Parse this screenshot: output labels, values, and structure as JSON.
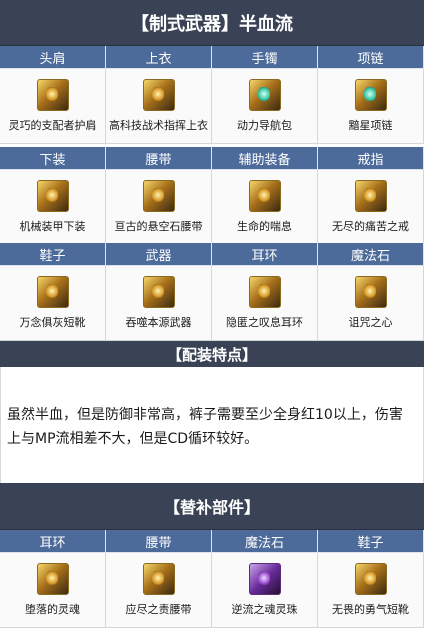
{
  "main_title": "【制式武器】半血流",
  "slots_row1": [
    {
      "slot": "头肩",
      "item": "灵巧的支配者护肩",
      "icon": "shoulder-armor-icon",
      "tint": ""
    },
    {
      "slot": "上衣",
      "item": "高科技战术指挥上衣",
      "icon": "chest-armor-icon",
      "tint": ""
    },
    {
      "slot": "手镯",
      "item": "动力导航包",
      "icon": "bracelet-icon",
      "tint": "teal"
    },
    {
      "slot": "项链",
      "item": "黯星项链",
      "icon": "necklace-icon",
      "tint": "teal"
    }
  ],
  "slots_row2": [
    {
      "slot": "下装",
      "item": "机械装甲下装",
      "icon": "leg-armor-icon",
      "tint": ""
    },
    {
      "slot": "腰带",
      "item": "亘古的悬空石腰带",
      "icon": "belt-icon",
      "tint": ""
    },
    {
      "slot": "辅助装备",
      "item": "生命的喘息",
      "icon": "support-gear-icon",
      "tint": ""
    },
    {
      "slot": "戒指",
      "item": "无尽的痛苦之戒",
      "icon": "ring-icon",
      "tint": ""
    }
  ],
  "slots_row3": [
    {
      "slot": "鞋子",
      "item": "万念俱灰短靴",
      "icon": "boots-icon",
      "tint": ""
    },
    {
      "slot": "武器",
      "item": "吞噬本源武器",
      "icon": "weapon-icon",
      "tint": ""
    },
    {
      "slot": "耳环",
      "item": "隐匿之叹息耳环",
      "icon": "earring-icon",
      "tint": ""
    },
    {
      "slot": "魔法石",
      "item": "诅咒之心",
      "icon": "magic-stone-icon",
      "tint": ""
    }
  ],
  "feature_title": "【配装特点】",
  "feature_text": "虽然半血，但是防御非常高，裤子需要至少全身红10以上，伤害上与MP流相差不大，但是CD循环较好。",
  "replace_title": "【替补部件】",
  "replace_slots": [
    {
      "slot": "耳环",
      "item": "堕落的灵魂",
      "icon": "earring-icon",
      "tint": ""
    },
    {
      "slot": "腰带",
      "item": "应尽之责腰带",
      "icon": "belt-icon",
      "tint": ""
    },
    {
      "slot": "魔法石",
      "item": "逆流之魂灵珠",
      "icon": "magic-stone-icon",
      "tint": "purple"
    },
    {
      "slot": "鞋子",
      "item": "无畏的勇气短靴",
      "icon": "boots-icon",
      "tint": ""
    }
  ],
  "colors": {
    "banner": "#3a4356",
    "header": "#4d6b9a",
    "cell": "#fafafa"
  }
}
